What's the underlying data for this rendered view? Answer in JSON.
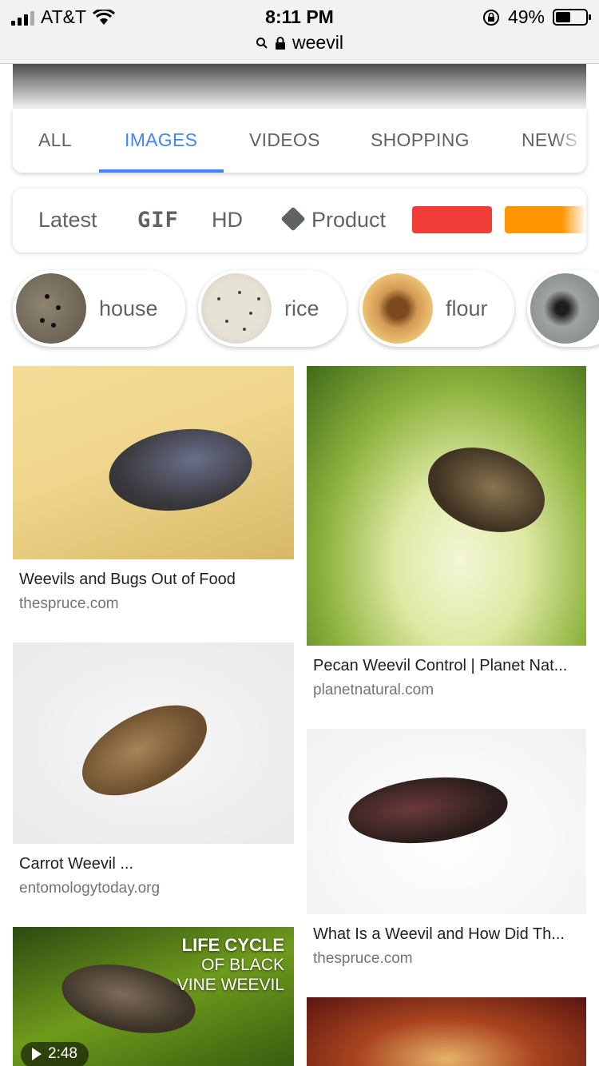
{
  "status_bar": {
    "carrier": "AT&T",
    "time": "8:11 PM",
    "battery_percent": "49%",
    "battery_level": 0.49
  },
  "address_bar": {
    "url_text": "weevil"
  },
  "tabs": [
    {
      "label": "ALL",
      "active": false
    },
    {
      "label": "IMAGES",
      "active": true
    },
    {
      "label": "VIDEOS",
      "active": false
    },
    {
      "label": "SHOPPING",
      "active": false
    },
    {
      "label": "NEWS",
      "active": false
    }
  ],
  "filters": {
    "latest": "Latest",
    "gif": "GIF",
    "hd": "HD",
    "product": "Product",
    "color_red": "#f13d37",
    "color_orange": "#ff9500"
  },
  "chips": [
    {
      "label": "house"
    },
    {
      "label": "rice"
    },
    {
      "label": "flour"
    },
    {
      "label": ""
    }
  ],
  "results": [
    {
      "title": "Weevils and Bugs Out of Food",
      "source": "thespruce.com"
    },
    {
      "title": "Pecan Weevil Control | Planet Nat...",
      "source": "planetnatural.com"
    },
    {
      "title": "Carrot Weevil ...",
      "source": "entomologytoday.org"
    },
    {
      "title": "What Is a Weevil and How Did Th...",
      "source": "thespruce.com"
    },
    {
      "overlay_line1": "LIFE CYCLE",
      "overlay_line2": "OF BLACK",
      "overlay_line3": "VINE WEEVIL",
      "duration": "2:48"
    }
  ]
}
